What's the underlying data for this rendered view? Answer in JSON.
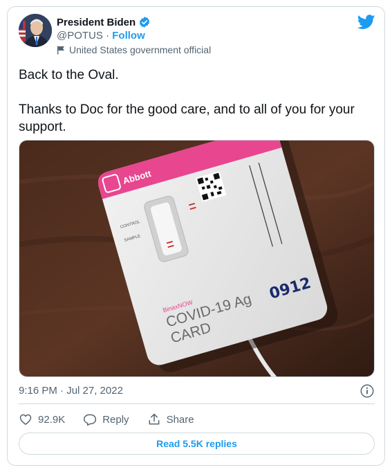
{
  "author": {
    "name": "President Biden",
    "handle": "@POTUS",
    "separator": "·",
    "follow_label": "Follow",
    "label_text": "United States government official"
  },
  "tweet": {
    "line1": "Back to the Oval.",
    "line2": "Thanks to Doc for the good care, and to all of you for your support."
  },
  "media": {
    "brand": "Abbott",
    "control_label": "CONTROL",
    "sample_label": "SAMPLE",
    "product_small": "BinaxNOW",
    "product_line1": "COVID-19 Ag",
    "product_line2": "CARD",
    "handwritten": "0912"
  },
  "meta": {
    "timestamp": "9:16 PM · Jul 27, 2022"
  },
  "actions": {
    "likes": "92.9K",
    "reply_label": "Reply",
    "share_label": "Share"
  },
  "read_replies_label": "Read 5.5K replies",
  "colors": {
    "twitter_blue": "#1d9bf0",
    "text_secondary": "#536471",
    "border": "#cfd9de",
    "card_pink": "#e8468f"
  }
}
